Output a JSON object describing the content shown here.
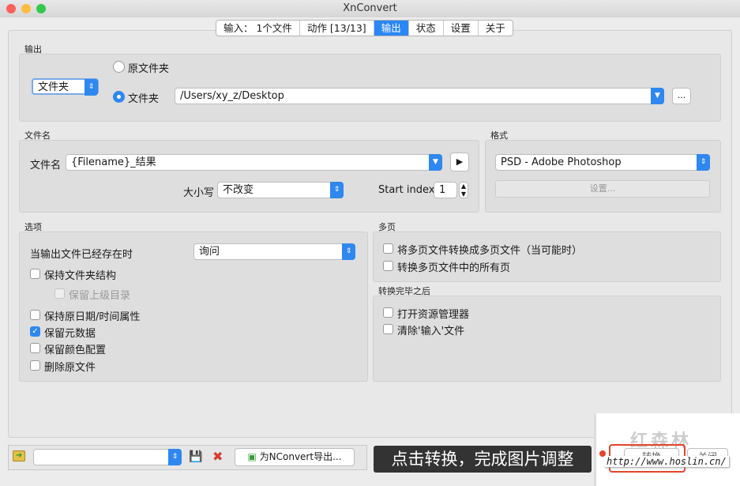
{
  "window": {
    "title": "XnConvert"
  },
  "tabs": [
    {
      "label": "输入： 1个文件"
    },
    {
      "label": "动作 [13/13]"
    },
    {
      "label": "输出"
    },
    {
      "label": "状态"
    },
    {
      "label": "设置"
    },
    {
      "label": "关于"
    }
  ],
  "output": {
    "section_label": "输出",
    "dest_type": "文件夹",
    "radio_original": "原文件夹",
    "radio_folder": "文件夹",
    "folder_path": "/Users/xy_z/Desktop",
    "browse_label": "..."
  },
  "filename": {
    "section_label": "文件名",
    "label": "文件名",
    "value": "{Filename}_结果",
    "case_label": "大小写",
    "case_value": "不改变",
    "start_index_label": "Start index",
    "start_index_value": "1"
  },
  "format": {
    "section_label": "格式",
    "value": "PSD - Adobe Photoshop",
    "settings_label": "设置..."
  },
  "options": {
    "section_label": "选项",
    "exists_label": "当输出文件已经存在时",
    "exists_value": "询问",
    "checks": [
      {
        "label": "保持文件夹结构",
        "checked": false
      },
      {
        "label": "保留上级目录",
        "checked": false,
        "disabled": true
      },
      {
        "label": "保持原日期/时间属性",
        "checked": false
      },
      {
        "label": "保留元数据",
        "checked": true
      },
      {
        "label": "保留颜色配置",
        "checked": false
      },
      {
        "label": "删除原文件",
        "checked": false
      }
    ]
  },
  "multipage": {
    "section_label": "多页",
    "checks": [
      {
        "label": "将多页文件转换成多页文件（当可能时）"
      },
      {
        "label": "转换多页文件中的所有页"
      }
    ]
  },
  "after": {
    "section_label": "转换完毕之后",
    "checks": [
      {
        "label": "打开资源管理器"
      },
      {
        "label": "清除'输入'文件"
      }
    ]
  },
  "bottom": {
    "export_label": "为NConvert导出...",
    "convert_label": "转换",
    "close_label": "关闭"
  },
  "overlay": {
    "subtitle": "点击转换，完成图片调整",
    "watermark_title": "红森林",
    "watermark_url": "http://www.hoslin.cn/"
  }
}
